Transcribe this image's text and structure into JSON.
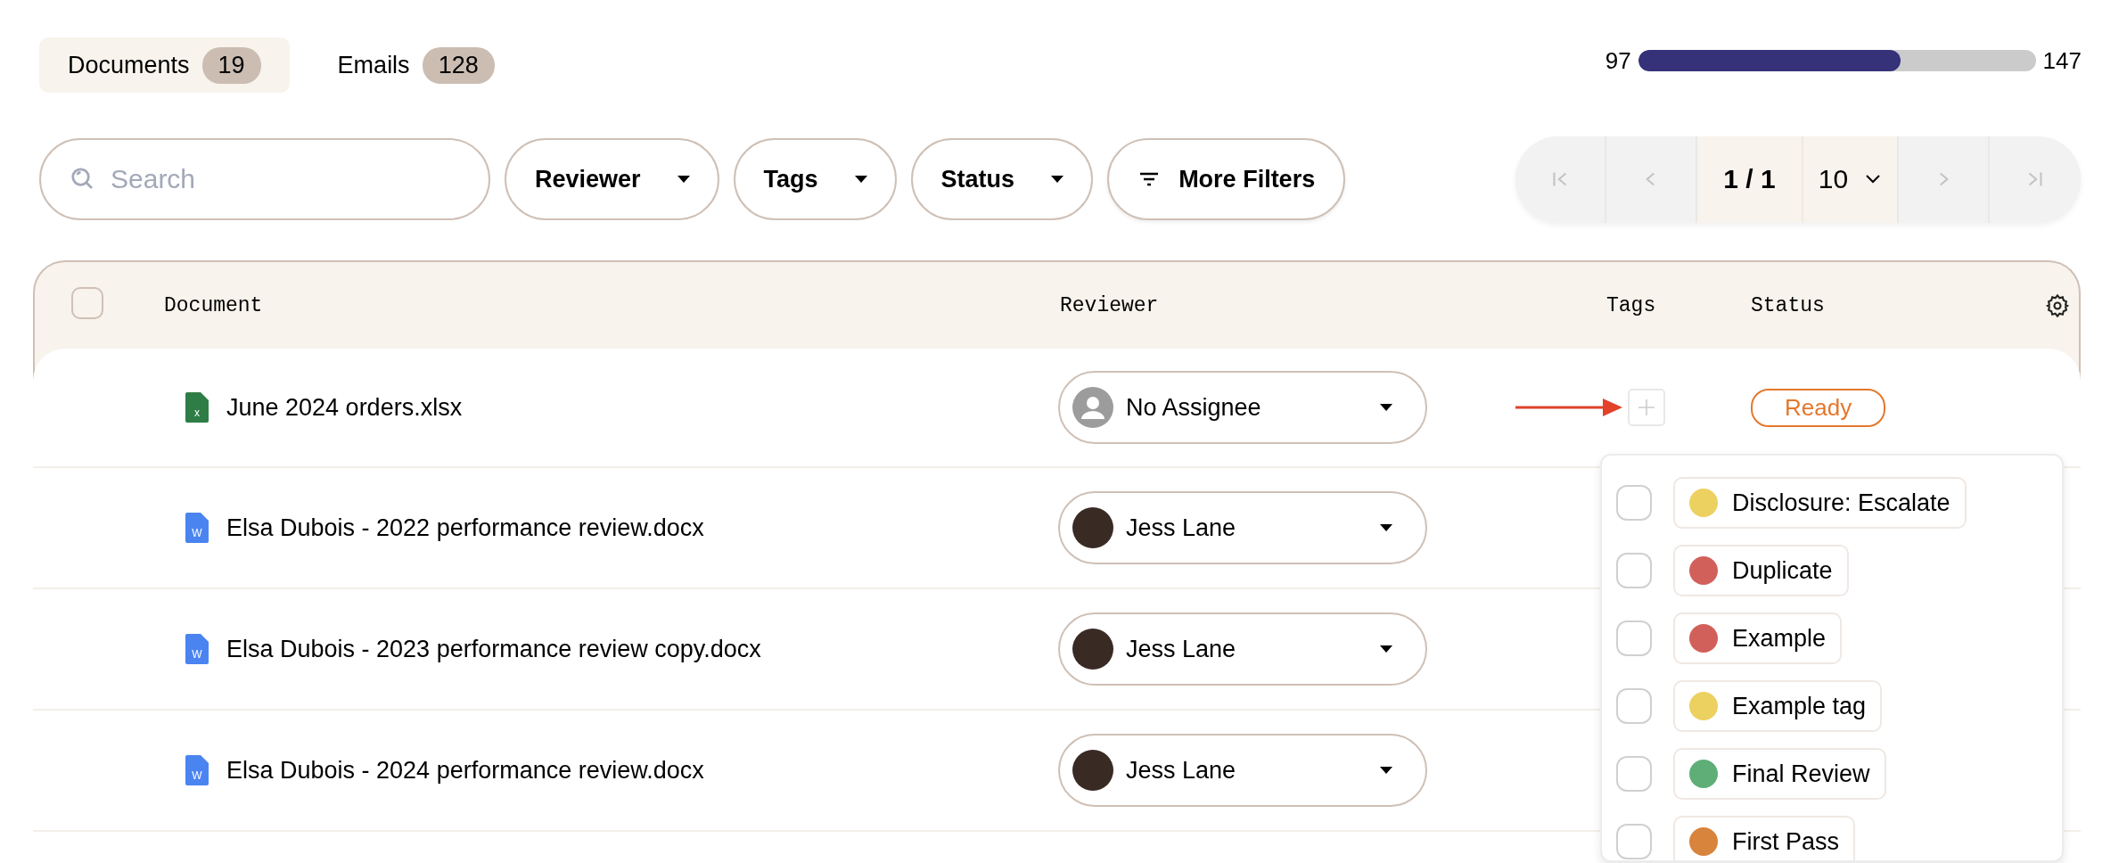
{
  "tabs": [
    {
      "label": "Documents",
      "count": "19",
      "selected": true
    },
    {
      "label": "Emails",
      "count": "128",
      "selected": false
    }
  ],
  "progress": {
    "start_label": "97",
    "end_label": "147",
    "level": 0.66
  },
  "search": {
    "placeholder": "Search"
  },
  "filters": [
    {
      "label": "Reviewer",
      "kind": "dropdown"
    },
    {
      "label": "Tags",
      "kind": "dropdown"
    },
    {
      "label": "Status",
      "kind": "dropdown"
    },
    {
      "label": "More Filters",
      "kind": "more"
    }
  ],
  "pagination": {
    "page": "1 / 1",
    "page_size": "10",
    "buttons": [
      {
        "kind": "first",
        "disabled": true
      },
      {
        "kind": "prev",
        "disabled": true
      },
      {
        "kind": "next",
        "disabled": true
      },
      {
        "kind": "last",
        "disabled": true
      }
    ]
  },
  "table": {
    "select_all": {
      "checked": false
    },
    "columns": [
      "Document",
      "Reviewer",
      "Tags",
      "Status"
    ],
    "rows": [
      {
        "document": {
          "name": "June 2024 orders.xlsx",
          "kind": "spreadsheet",
          "icon_text": "x"
        },
        "reviewer": {
          "name": "No Assignee",
          "kind": "none"
        },
        "status": "Ready",
        "pointer_arrow": true
      },
      {
        "document": {
          "name": "Elsa Dubois - 2022 performance review.docx",
          "kind": "word",
          "icon_text": "W"
        },
        "reviewer": {
          "name": "Jess Lane",
          "kind": "person"
        },
        "pointer_arrow": false
      },
      {
        "document": {
          "name": "Elsa Dubois - 2023 performance review copy.docx",
          "kind": "word",
          "icon_text": "W"
        },
        "reviewer": {
          "name": "Jess Lane",
          "kind": "person"
        },
        "pointer_arrow": false
      },
      {
        "document": {
          "name": "Elsa Dubois - 2024 performance review.docx",
          "kind": "word",
          "icon_text": "W"
        },
        "reviewer": {
          "name": "Jess Lane",
          "kind": "person"
        },
        "pointer_arrow": false
      }
    ]
  },
  "tag_menu": {
    "items": [
      {
        "label": "Disclosure: Escalate",
        "color": "#ecd160",
        "checked": false
      },
      {
        "label": "Duplicate",
        "color": "#d2605a",
        "checked": false
      },
      {
        "label": "Example",
        "color": "#d2605a",
        "checked": false
      },
      {
        "label": "Example tag",
        "color": "#ecd160",
        "checked": false
      },
      {
        "label": "Final Review",
        "color": "#5fae78",
        "checked": false
      },
      {
        "label": "First Pass",
        "color": "#d8843c",
        "checked": false
      }
    ]
  }
}
